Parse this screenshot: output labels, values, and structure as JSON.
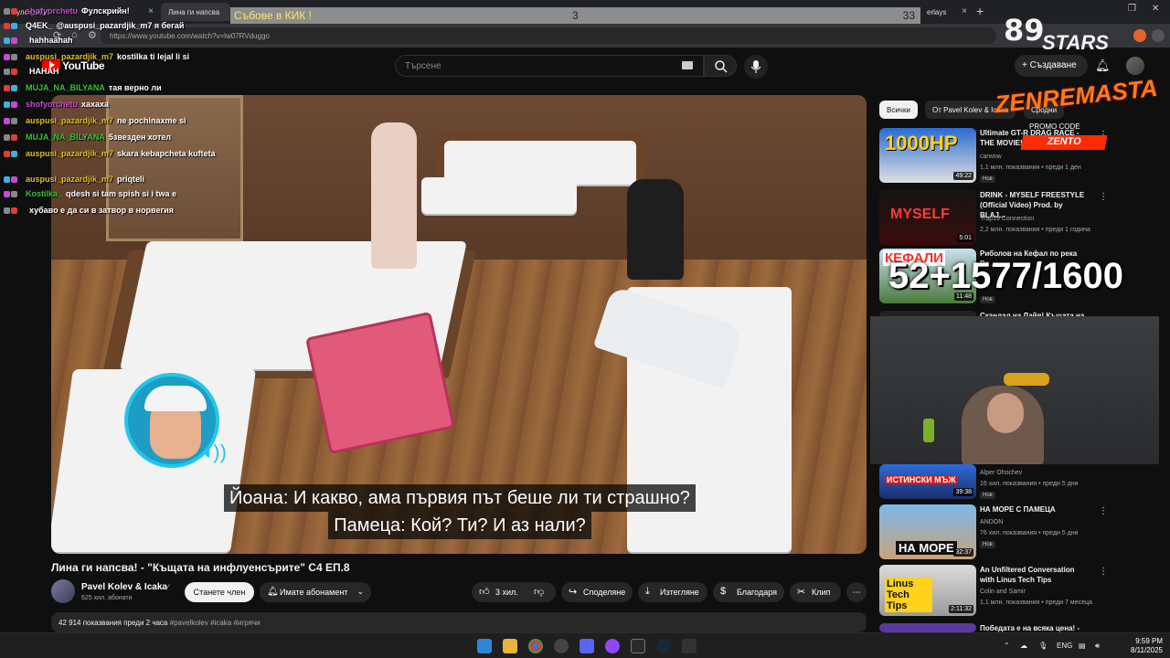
{
  "browser": {
    "tabs": [
      {
        "label": "Фулскрийн!"
      },
      {
        "label": "Лина ги напсва"
      },
      {
        "label": "erlays"
      }
    ],
    "url": "https://www.youtube.com/watch?v=lw07RVduggo"
  },
  "kik_bar": {
    "title": "Събове в КИК !",
    "current": "3",
    "goal": "33"
  },
  "youtube": {
    "logo_text": "YouTube",
    "search_placeholder": "Търсене",
    "create_label": "Създаване"
  },
  "video": {
    "subtitle_line1": "Йоана: И какво, ама първия път беше ли ти страшно?",
    "subtitle_line2": "Памеца: Кой? Ти? И аз нали?",
    "title": "Лина ги напсва! - \"Къщата на инфлуенсърите\" С4 ЕП.8",
    "channel": "Pavel Kolev & Icaka",
    "subscribers": "625 хил. абонати",
    "join_label": "Станете член",
    "subscribed_label": "Имате абонамент",
    "likes": "3 хил.",
    "share_label": "Споделяне",
    "download_label": "Изтегляне",
    "thanks_label": "Благодаря",
    "clip_label": "Клип",
    "views_line": "42 914 показвания  преди 2 часа",
    "tags": "#pavelkolev #icaka #игрячи"
  },
  "sidebar": {
    "chips": [
      {
        "label": "Всички"
      },
      {
        "label": "От Pavel Kolev & Icaka"
      },
      {
        "label": "Сродни"
      }
    ],
    "recommendations": [
      {
        "title": "Ultimate GT-R DRAG RACE - THE MOVIE!",
        "channel": "carwow",
        "meta": "1,1 млн. показвания • преди 1 ден",
        "duration": "49:22",
        "badge": "Нов",
        "thumb_text": "1000HP"
      },
      {
        "title": "DRINK - MYSELF FREESTYLE (Official Video) Prod. by BLAJ...",
        "channel": "Trap19 Connection",
        "meta": "2,2 млн. показвания • преди 1 година",
        "duration": "5:01",
        "badge": "",
        "thumb_text": "MYSELF"
      },
      {
        "title": "Риболов на Кефал по река Ва...",
        "channel": "",
        "meta": "",
        "duration": "11:48",
        "badge": "Нов",
        "thumb_text": "КЕФАЛИ"
      },
      {
        "title": "Скандал на Лайв! Къщата на",
        "channel": "",
        "meta": "",
        "duration": "",
        "badge": "",
        "thumb_text": ""
      },
      {
        "title": "",
        "channel": "Alper Ohochev",
        "meta": "16 хил. показвания • преди 5 дни",
        "duration": "39:38",
        "badge": "Нов",
        "thumb_text": "ИСТИНСКИ МЪЖ"
      },
      {
        "title": "НА МОРЕ С ПАМЕЦА",
        "channel": "ANDON",
        "meta": "76 хил. показвания • преди 5 дни",
        "duration": "32:37",
        "badge": "Нов",
        "thumb_text": "НА МОРЕ"
      },
      {
        "title": "An Unfiltered Conversation with Linus Tech Tips",
        "channel": "Colin and Samir",
        "meta": "1,1 млн. показвания • преди 7 месеца",
        "duration": "2:11:32",
        "badge": "",
        "thumb_text": "Linus Tech Tips"
      },
      {
        "title": "Победата е на всяка цена! -",
        "channel": "",
        "meta": "",
        "duration": "",
        "badge": "",
        "thumb_text": ""
      }
    ]
  },
  "overlay": {
    "stars_number": "89",
    "stars_word": "STARS",
    "zen_text": "ZENREMASTA",
    "promo_label": "PROMO CODE",
    "promo_code": "ZENTO",
    "sub_counter": "52+1577/1600"
  },
  "chat": [
    {
      "user": "shofyorchetu",
      "text": "Фулскрийн!",
      "color": "#c44bd6"
    },
    {
      "user": "Q4EK_",
      "text": "@auspusi_pazardjik_m7 я бегай",
      "color": "#ffffff"
    },
    {
      "user": "",
      "text": "hahhaahah",
      "color": "#4a8cff"
    },
    {
      "user": "auspusi_pazardjik_m7",
      "text": "kostilka ti lejal li si",
      "color": "#e0c020"
    },
    {
      "user": "",
      "text": "HAHAH",
      "color": "#4a8cff"
    },
    {
      "user": "MUJA_NA_BILYANA",
      "text": "тая верно ли",
      "color": "#35c435"
    },
    {
      "user": "shofyorchetu",
      "text": "хахаха",
      "color": "#c44bd6"
    },
    {
      "user": "auspusi_pazardjik_m7",
      "text": "ne pochinaxme si",
      "color": "#e0c020"
    },
    {
      "user": "MUJA_NA_BILYANA",
      "text": "5звезден хотел",
      "color": "#35c435"
    },
    {
      "user": "auspusi_pazardjik_m7",
      "text": "skara kebapcheta kufteta",
      "color": "#e0c020"
    },
    {
      "user": "auspusi_pazardjik_m7",
      "text": "priqteli",
      "color": "#e0c020"
    },
    {
      "user": "Kostilka_",
      "text": "qdesh si tam spish si i twa e",
      "color": "#35c435"
    },
    {
      "user": "",
      "text": "хубаво е да си в затвор в норвегия",
      "color": "#ff4040"
    }
  ],
  "taskbar": {
    "lang": "ENG",
    "time": "9:59 PM",
    "date": "8/11/2025"
  }
}
